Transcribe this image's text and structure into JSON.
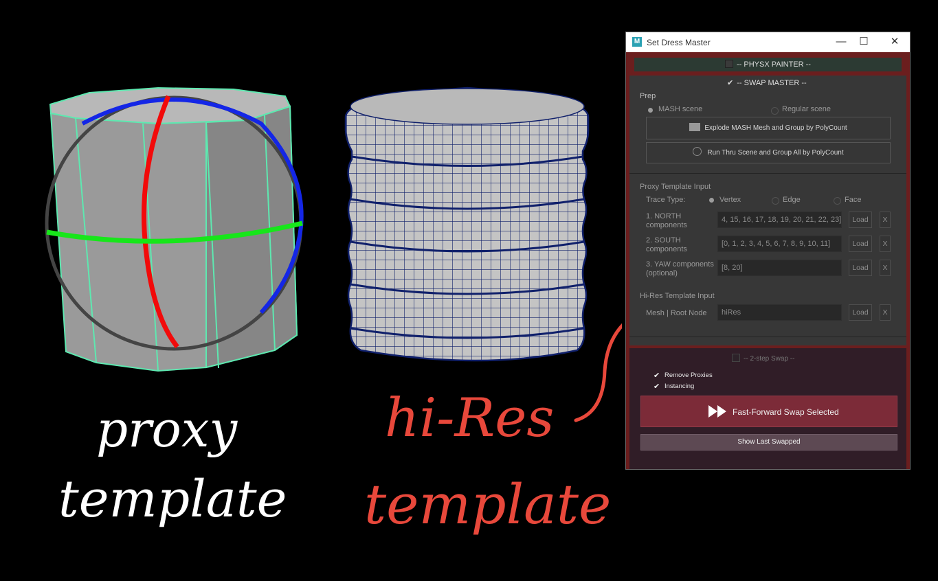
{
  "illustration": {
    "left_caption": [
      "proxy",
      "template"
    ],
    "right_caption": [
      "hi-Res",
      "template"
    ],
    "left_caption_color": "#ffffff",
    "right_caption_color": "#e8483b"
  },
  "window": {
    "title": "Set Dress Master",
    "minimize_glyph": "—",
    "maximize_glyph": "☐",
    "close_glyph": "✕",
    "physx_label": "--  PHYSX PAINTER  --",
    "swap_master_label": "--  SWAP MASTER  --",
    "swap_master_check": "✔",
    "prep": {
      "heading": "Prep",
      "mash_radio": "MASH scene",
      "regular_radio": "Regular scene",
      "explode_button": "Explode MASH Mesh and Group by PolyCount",
      "run_thru_button": "Run Thru Scene and Group All by PolyCount"
    },
    "proxy": {
      "heading": "Proxy Template Input",
      "trace_type_label": "Trace Type:",
      "vertex": "Vertex",
      "edge": "Edge",
      "face": "Face",
      "rows": [
        {
          "label_line1": "1. NORTH",
          "label_line2": "components",
          "value": "4, 15, 16, 17, 18, 19, 20, 21, 22, 23]",
          "load": "Load",
          "clear": "X"
        },
        {
          "label_line1": "2. SOUTH",
          "label_line2": "components",
          "value": "[0, 1, 2, 3, 4, 5, 6, 7, 8, 9, 10, 11]",
          "load": "Load",
          "clear": "X"
        },
        {
          "label_line1": "3. YAW components",
          "label_line2": "(optional)",
          "value": "[8, 20]",
          "load": "Load",
          "clear": "X"
        }
      ]
    },
    "hires": {
      "heading": "Hi-Res Template Input",
      "label": "Mesh | Root Node",
      "value": "hiRes",
      "load": "Load",
      "clear": "X"
    },
    "two_step": {
      "label": "--  2-step Swap  --",
      "remove_proxies": "Remove Proxies",
      "instancing": "Instancing",
      "check": "✔",
      "fast_forward_button": "Fast-Forward Swap Selected",
      "show_last_button": "Show Last Swapped"
    }
  }
}
